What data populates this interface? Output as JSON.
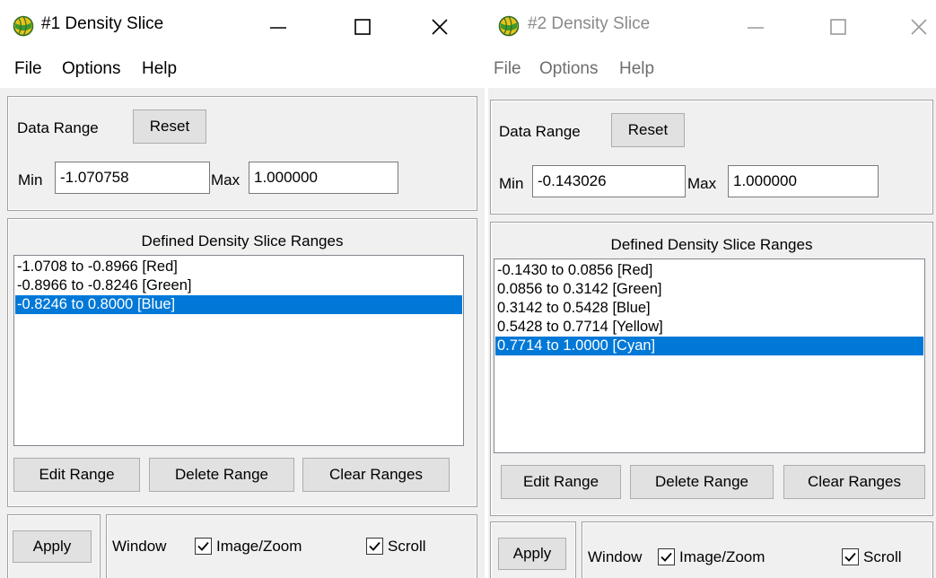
{
  "window1": {
    "title": "#1 Density Slice",
    "menu": [
      "File",
      "Options",
      "Help"
    ],
    "data_range_label": "Data Range",
    "reset_label": "Reset",
    "min_label": "Min",
    "min_value": "-1.070758",
    "max_label": "Max",
    "max_value": "1.000000",
    "list_title": "Defined Density Slice Ranges",
    "ranges": [
      "-1.0708 to -0.8966 [Red]",
      "-0.8966 to -0.8246 [Green]",
      "-0.8246 to 0.8000 [Blue]"
    ],
    "selected_range_index": 2,
    "edit_range_label": "Edit Range",
    "delete_range_label": "Delete Range",
    "clear_ranges_label": "Clear Ranges",
    "apply_label": "Apply",
    "window_label": "Window",
    "image_zoom_label": "Image/Zoom",
    "image_zoom_checked": true,
    "scroll_label": "Scroll",
    "scroll_checked": true
  },
  "window2": {
    "title": "#2 Density Slice",
    "menu": [
      "File",
      "Options",
      "Help"
    ],
    "data_range_label": "Data Range",
    "reset_label": "Reset",
    "min_label": "Min",
    "min_value": "-0.143026",
    "max_label": "Max",
    "max_value": "1.000000",
    "list_title": "Defined Density Slice Ranges",
    "ranges": [
      "-0.1430 to 0.0856 [Red]",
      "0.0856 to 0.3142 [Green]",
      "0.3142 to 0.5428 [Blue]",
      "0.5428 to 0.7714 [Yellow]",
      "0.7714 to 1.0000 [Cyan]"
    ],
    "selected_range_index": 4,
    "edit_range_label": "Edit Range",
    "delete_range_label": "Delete Range",
    "clear_ranges_label": "Clear Ranges",
    "apply_label": "Apply",
    "window_label": "Window",
    "image_zoom_label": "Image/Zoom",
    "image_zoom_checked": true,
    "scroll_label": "Scroll",
    "scroll_checked": true
  },
  "colors": {
    "selection": "#0078d7",
    "dialog_bg": "#f0f0f0",
    "titlebar_bg": "#ffffff",
    "inactive_title": "#8a8a8a",
    "icon_green": "#3c9a2f",
    "icon_yellow": "#e8c21a"
  },
  "icons": [
    "app-globe-icon",
    "minimize-icon",
    "maximize-icon",
    "close-icon",
    "checkmark-icon"
  ]
}
